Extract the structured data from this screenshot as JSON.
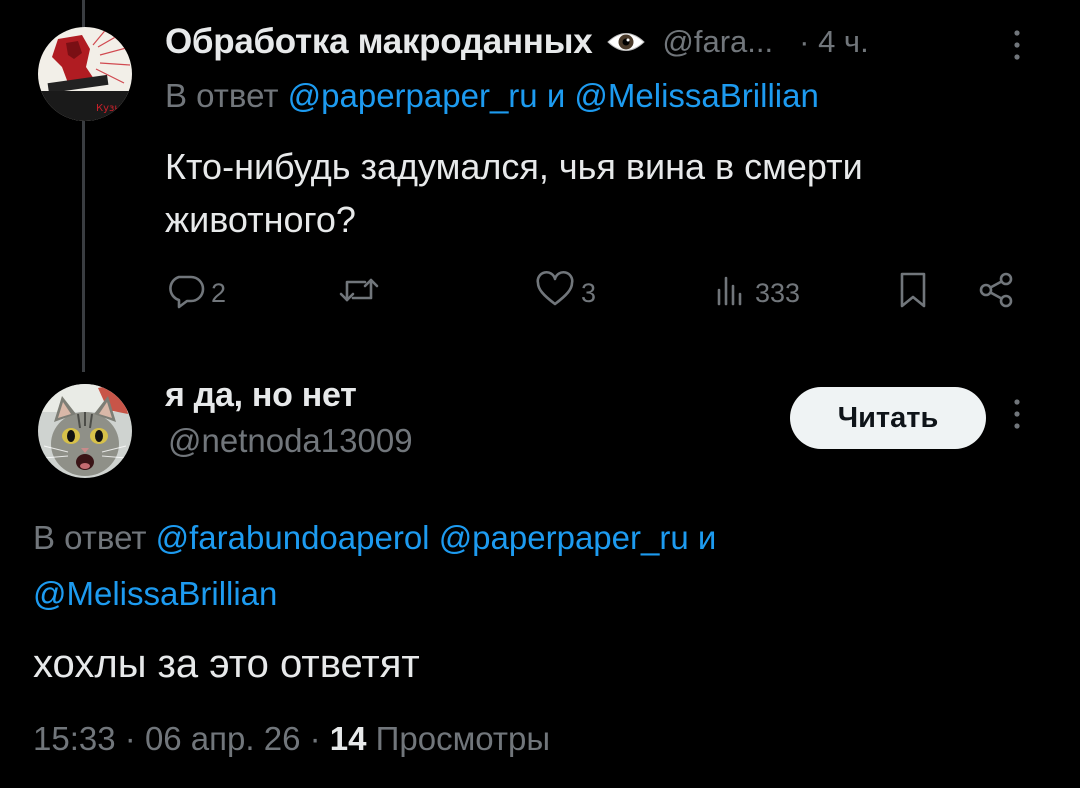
{
  "post1": {
    "author_name": "Обработка макроданных",
    "badge_icon": "eye-icon",
    "handle": "@fara...",
    "separator": "·",
    "time": "4 ч.",
    "reply_prefix": "В ответ",
    "reply_to_1": "@paperpaper_ru",
    "reply_and": "и",
    "reply_to_2": "@MelissaBrillian",
    "text": "Кто-нибудь задумался, чья вина в смерти животного?",
    "avatar_label": "Кузне",
    "actions": {
      "replies": "2",
      "retweets": "",
      "likes": "3",
      "views": "333"
    }
  },
  "post2": {
    "author_name": "я да, но нет",
    "handle": "@netnoda13009",
    "follow_label": "Читать",
    "reply_prefix": "В ответ",
    "reply_to_1": "@farabundoaperol",
    "reply_to_2": "@paperpaper_ru",
    "reply_and": "и",
    "reply_to_3": "@MelissaBrillian",
    "text": "хохлы за это ответят",
    "time": "15:33",
    "sep1": "·",
    "date": "06 апр. 26",
    "sep2": "·",
    "views_count": "14",
    "views_label": "Просмотры"
  },
  "colors": {
    "background": "#000000",
    "text": "#e7e9ea",
    "muted": "#71767b",
    "link": "#1d9bf0",
    "button_bg": "#eff3f4"
  }
}
